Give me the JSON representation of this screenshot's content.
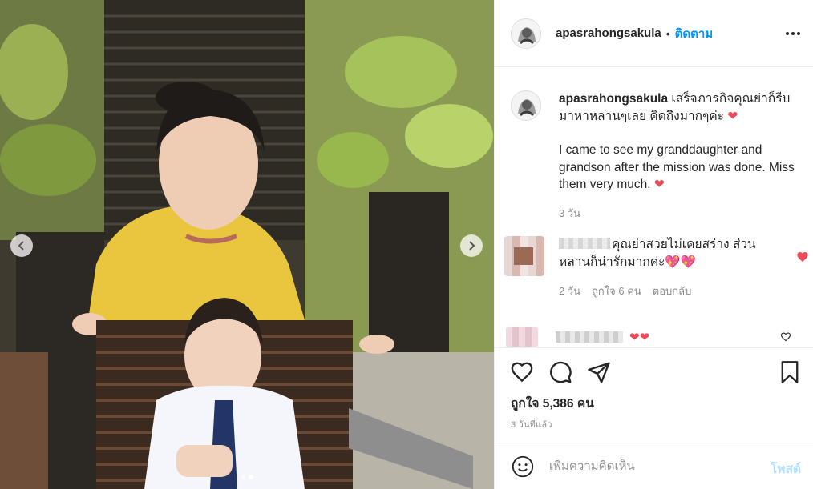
{
  "post": {
    "username": "apasrahongsakula",
    "separator": "•",
    "follow_label": "ติดตาม",
    "more_icon": "more-horizontal-icon"
  },
  "caption": {
    "username": "apasrahongsakula",
    "text_th": "เสร็จภารกิจคุณย่าก็รีบมาหาหลานๆเลย คิดถึงมากๆค่ะ",
    "text_en": "I came to see my granddaughter and grandson after the mission was done. Miss them very much.",
    "emoji": "❤",
    "time": "3 วัน"
  },
  "comments": [
    {
      "text": "คุณย่าสวยไม่เคยสร่าง ส่วนหลานก็น่ารักมากค่ะ",
      "emoji": "💖💖",
      "time": "2 วัน",
      "likes": "ถูกใจ 6 คน",
      "reply_label": "ตอบกลับ"
    },
    {
      "emoji": "❤❤"
    }
  ],
  "actions": {
    "like_icon": "heart-outline-icon",
    "comment_icon": "comment-icon",
    "share_icon": "share-icon",
    "save_icon": "bookmark-icon",
    "likes_text": "ถูกใจ 5,386 คน",
    "posted_time": "3 วันที่แล้ว"
  },
  "composer": {
    "placeholder": "เพิ่มความคิดเห็น",
    "post_label": "โพสต์"
  },
  "carousel": {
    "current": 1,
    "total": 2
  },
  "colors": {
    "link_blue": "#0095f6",
    "heart_red": "#ed4956",
    "disabled_blue": "#b2dffc",
    "secondary_text": "#8e8e8e"
  }
}
